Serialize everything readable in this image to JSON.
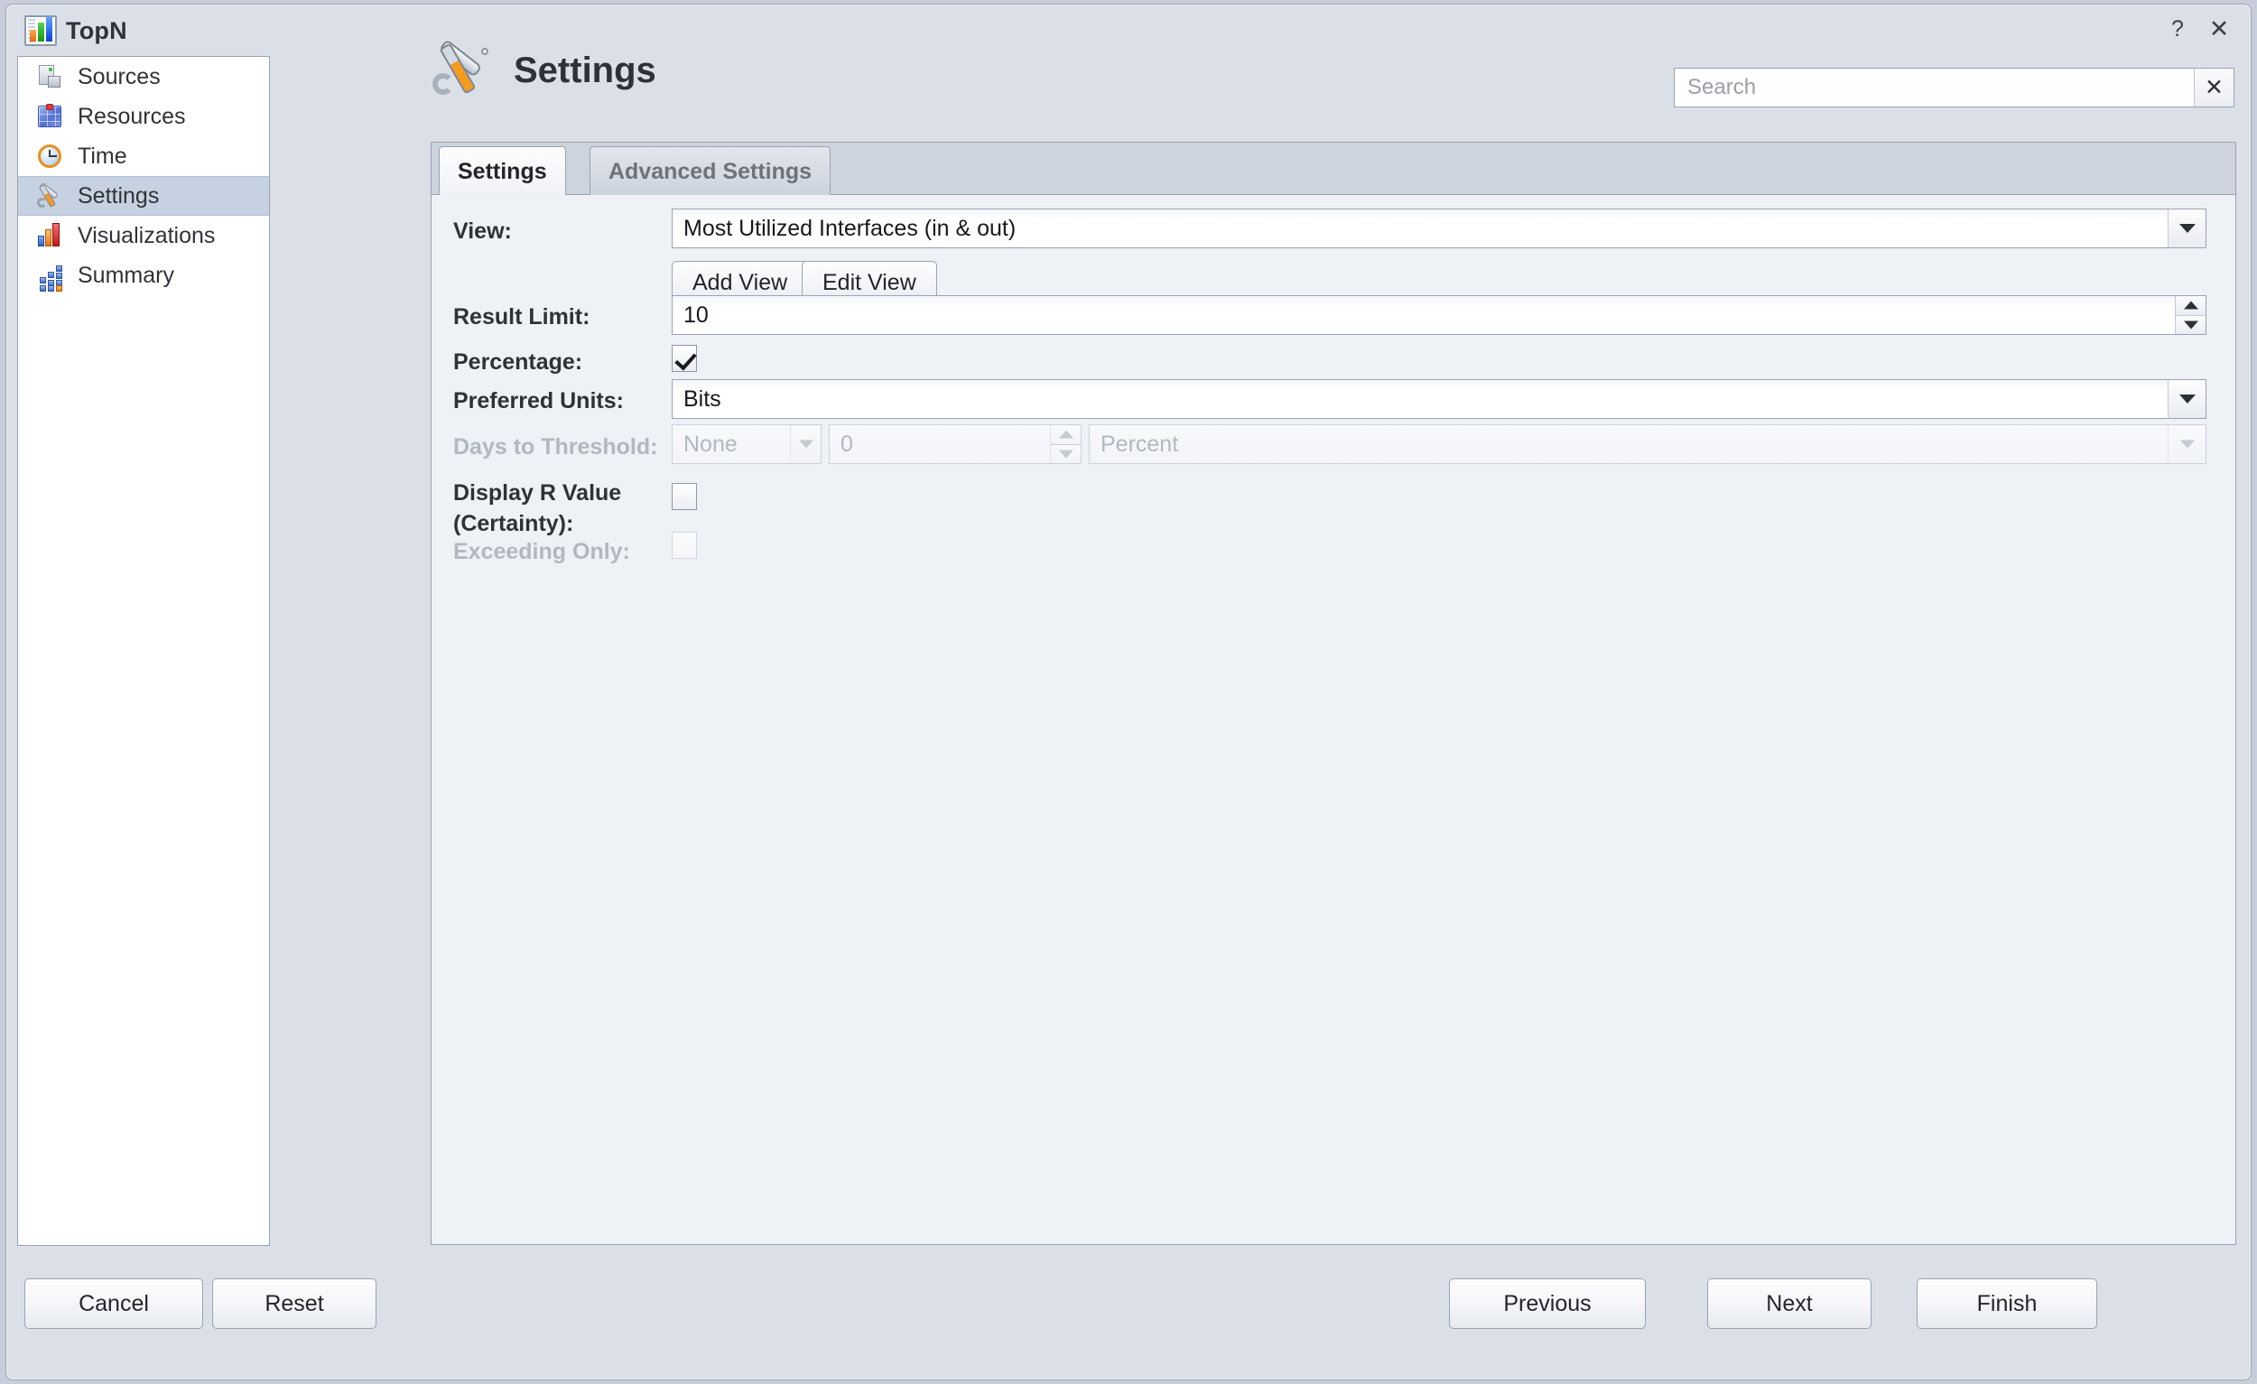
{
  "window": {
    "title": "TopN",
    "icon": "bar-chart-icon",
    "help_label": "?",
    "close_label": "✕"
  },
  "sidebar": {
    "items": [
      {
        "label": "Sources",
        "icon": "server-icon",
        "selected": false
      },
      {
        "label": "Resources",
        "icon": "cube-icon",
        "selected": false
      },
      {
        "label": "Time",
        "icon": "clock-icon",
        "selected": false
      },
      {
        "label": "Settings",
        "icon": "tools-icon",
        "selected": true
      },
      {
        "label": "Visualizations",
        "icon": "bar-chart-icon",
        "selected": false
      },
      {
        "label": "Summary",
        "icon": "grid-icon",
        "selected": false
      }
    ]
  },
  "header": {
    "title": "Settings",
    "icon": "tools-icon"
  },
  "search": {
    "value": "",
    "placeholder": "Search",
    "clear_label": "✕"
  },
  "tabs": [
    {
      "label": "Settings",
      "active": true
    },
    {
      "label": "Advanced Settings",
      "active": false
    }
  ],
  "form": {
    "view": {
      "label": "View:",
      "value": "Most Utilized Interfaces (in & out)",
      "add_button": "Add View",
      "edit_button": "Edit View"
    },
    "result_limit": {
      "label": "Result Limit:",
      "value": "10"
    },
    "percentage": {
      "label": "Percentage:",
      "checked": true
    },
    "preferred_units": {
      "label": "Preferred Units:",
      "value": "Bits"
    },
    "days_to_threshold": {
      "label": "Days to Threshold:",
      "mode_value": "None",
      "amount_value": "0",
      "unit_value": "Percent",
      "disabled": true
    },
    "display_r_value": {
      "label": "Display R Value (Certainty):",
      "label_line1": "Display R Value",
      "label_line2": "(Certainty):",
      "checked": false
    },
    "exceeding_only": {
      "label": "Exceeding Only:",
      "checked": false,
      "disabled": true
    }
  },
  "footer": {
    "cancel": "Cancel",
    "reset": "Reset",
    "previous": "Previous",
    "next": "Next",
    "finish": "Finish"
  }
}
